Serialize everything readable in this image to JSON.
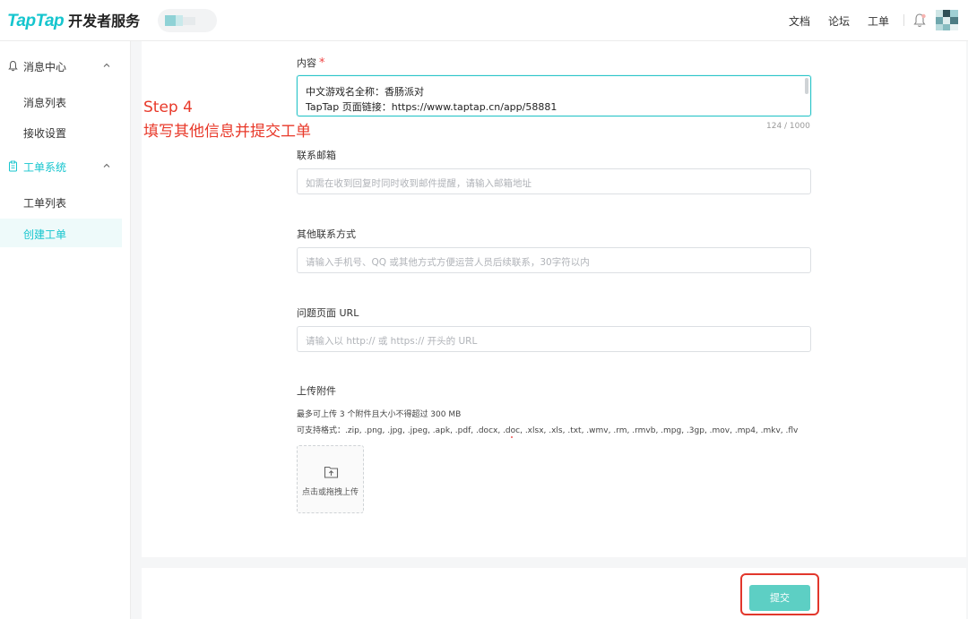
{
  "header": {
    "logo_brand": "TapTap",
    "logo_suffix": "开发者服务",
    "nav": {
      "docs": "文档",
      "forum": "论坛",
      "tickets": "工单"
    }
  },
  "sidebar": {
    "groups": [
      {
        "label": "消息中心",
        "icon": "bell-icon",
        "expanded": true,
        "items": [
          {
            "label": "消息列表"
          },
          {
            "label": "接收设置"
          }
        ]
      },
      {
        "label": "工单系统",
        "icon": "clipboard-icon",
        "expanded": true,
        "active": true,
        "items": [
          {
            "label": "工单列表"
          },
          {
            "label": "创建工单",
            "selected": true
          }
        ]
      }
    ]
  },
  "form": {
    "content": {
      "label": "内容",
      "required_mark": "*",
      "lines": [
        "中文游戏名全称：香肠派对",
        "TapTap 页面链接：https://www.taptap.cn/app/58881"
      ],
      "counter": "124 / 1000"
    },
    "email": {
      "label": "联系邮箱",
      "placeholder": "如需在收到回复时同时收到邮件提醒，请输入邮箱地址"
    },
    "other_contact": {
      "label": "其他联系方式",
      "placeholder": "请输入手机号、QQ 或其他方式方便运营人员后续联系，30字符以内"
    },
    "page_url": {
      "label": "问题页面 URL",
      "placeholder": "请输入以 http:// 或 https:// 开头的 URL"
    },
    "attachments": {
      "label": "上传附件",
      "limit_hint": "最多可上传 3 个附件且大小不得超过 300 MB",
      "formats_hint": "可支持格式：.zip, .png, .jpg, .jpeg, .apk, .pdf, .docx, .doc, .xlsx, .xls, .txt, .wmv, .rm, .rmvb, .mpg, .3gp, .mov, .mp4, .mkv, .flv",
      "upload_label": "点击或拖拽上传"
    },
    "submit_label": "提交"
  },
  "annotation": {
    "step": "Step 4",
    "text": "填写其他信息并提交工单",
    "color": "#e8392a"
  },
  "colors": {
    "brand": "#15c5ce",
    "submit": "#5dcfc4",
    "highlight_frame": "#e2372c"
  }
}
